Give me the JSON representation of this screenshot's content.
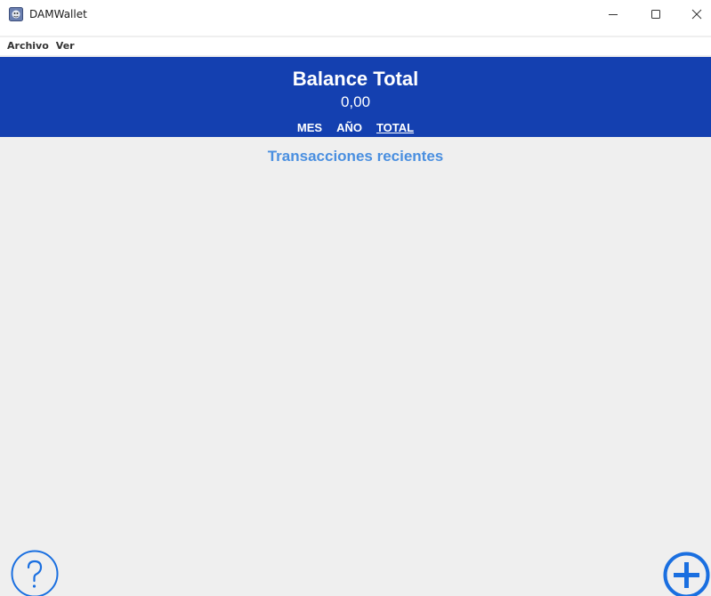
{
  "window": {
    "title": "DAMWallet",
    "controls": {
      "minimize_icon": "minimize-icon",
      "maximize_icon": "maximize-icon",
      "close_icon": "close-icon"
    }
  },
  "menubar": {
    "items": [
      {
        "label": "Archivo"
      },
      {
        "label": "Ver"
      }
    ]
  },
  "header": {
    "title": "Balance Total",
    "balance": "0,00",
    "tabs": [
      {
        "label": "MES",
        "active": false
      },
      {
        "label": "AÑO",
        "active": false
      },
      {
        "label": "TOTAL",
        "active": true
      }
    ],
    "background": "#1440b0"
  },
  "main": {
    "recent_title": "Transacciones recientes",
    "transactions": []
  },
  "buttons": {
    "help_icon": "help-icon",
    "add_icon": "add-icon",
    "accent": "#1a6fe0"
  }
}
